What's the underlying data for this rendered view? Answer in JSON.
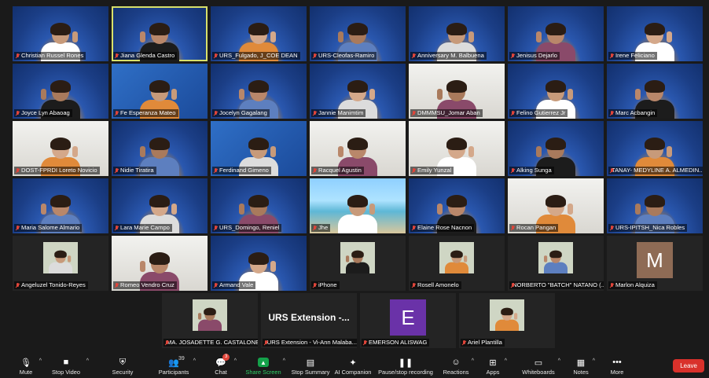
{
  "colors": {
    "toolbar_bg": "#1a1a1a",
    "leave_btn": "#d9312b",
    "share_green": "#14a14a",
    "mute_red": "#e0453a"
  },
  "rows": [
    [
      {
        "name": "Christian Russel Rones",
        "bg": "blue"
      },
      {
        "name": "Jiana Glenda Castro",
        "bg": "blue",
        "active": true
      },
      {
        "name": "URS_Fulgado, J_COE DEAN",
        "bg": "blue"
      },
      {
        "name": "URS-Cleofas-Ramiro",
        "bg": "blue"
      },
      {
        "name": "Anniversary M. Balbuena",
        "bg": "blue"
      },
      {
        "name": "Jenisus Dejarlo",
        "bg": "blue"
      },
      {
        "name": "Irene Feliciano",
        "bg": "blue"
      }
    ],
    [
      {
        "name": "Joyce Lyn Abaoag",
        "bg": "blue"
      },
      {
        "name": "Fe Esperanza Mateo",
        "bg": "brand"
      },
      {
        "name": "Jocelyn Gagalang",
        "bg": "blue"
      },
      {
        "name": "Jannie Manimtim",
        "bg": "blue"
      },
      {
        "name": "DMMMSU_Jomar Aban",
        "bg": "room"
      },
      {
        "name": "Felino Gutierrez Jr",
        "bg": "blue"
      },
      {
        "name": "Marc Acbangin",
        "bg": "blue"
      }
    ],
    [
      {
        "name": "DOST-FPRDI Loreto Novicio",
        "bg": "room"
      },
      {
        "name": "Nidie Tiratira",
        "bg": "blue"
      },
      {
        "name": "Ferdinand Gimeno",
        "bg": "brand"
      },
      {
        "name": "Racquel Agustin",
        "bg": "room"
      },
      {
        "name": "Emily Yunzal",
        "bg": "room"
      },
      {
        "name": "Alking Sunga",
        "bg": "blue"
      },
      {
        "name": "TANAY- MEDYLINE A. ALMEDIN...",
        "bg": "blue"
      }
    ],
    [
      {
        "name": "Maria Salome Almario",
        "bg": "blue"
      },
      {
        "name": "Lara Marie Campo",
        "bg": "blue"
      },
      {
        "name": "URS_Domingo, Reniel",
        "bg": "blue"
      },
      {
        "name": "Jhe",
        "bg": "sea"
      },
      {
        "name": "Elaine Rose Nacnon",
        "bg": "blue"
      },
      {
        "name": "Rocan Pangan",
        "bg": "room"
      },
      {
        "name": "URS-IPITSH_Nica Robles",
        "bg": "blue"
      }
    ],
    [
      {
        "name": "Angeluzel Tonido-Reyes",
        "bg": "dark",
        "thumb": "photo"
      },
      {
        "name": "Romeo Vendro Cruz",
        "bg": "room"
      },
      {
        "name": "Armand Vale",
        "bg": "blue"
      },
      {
        "name": "iPhone",
        "bg": "dark",
        "thumb": "photo"
      },
      {
        "name": "Rosell Amonelo",
        "bg": "dark",
        "thumb": "photo"
      },
      {
        "name": "NORBERTO \"BATCH\" NATANO (...",
        "bg": "dark",
        "thumb": "photo"
      },
      {
        "name": "Marlon Alquiza",
        "bg": "dark",
        "letter": "M",
        "letter_color": "#8e6b55"
      }
    ]
  ],
  "bottom_row": [
    {
      "name": "MA. JOSADETTE G. CASTALONE",
      "bg": "dark",
      "thumb": "photo"
    },
    {
      "name": "URS Extension - Vi-Ann Malaba...",
      "bg": "dark",
      "big": "URS  Extension  -..."
    },
    {
      "name": "EMERSON ALISWAG",
      "bg": "dark",
      "letter": "E",
      "letter_color": "#6a32a8"
    },
    {
      "name": "Ariel Plantilla",
      "bg": "dark",
      "thumb": "photo"
    }
  ],
  "toolbar": {
    "mute": "Mute",
    "stop_video": "Stop Video",
    "security": "Security",
    "participants": "Participants",
    "participants_count": "39",
    "chat": "Chat",
    "chat_badge": "3",
    "share_screen": "Share Screen",
    "stop_summary": "Stop Summary",
    "ai_companion": "AI Companion",
    "pause_recording": "Pause/stop recording",
    "reactions": "Reactions",
    "apps": "Apps",
    "whiteboards": "Whiteboards",
    "notes": "Notes",
    "more": "More",
    "leave": "Leave"
  },
  "icons": {
    "mute": "microphone-icon",
    "video": "video-camera-icon",
    "security": "shield-icon",
    "participants": "people-icon",
    "chat": "chat-bubble-icon",
    "share": "share-screen-icon",
    "summary": "document-icon",
    "ai": "sparkle-icon",
    "record": "pause-icon",
    "reactions": "smiley-icon",
    "apps": "apps-icon",
    "whiteboards": "whiteboard-icon",
    "notes": "notes-icon",
    "more": "more-dots-icon"
  }
}
